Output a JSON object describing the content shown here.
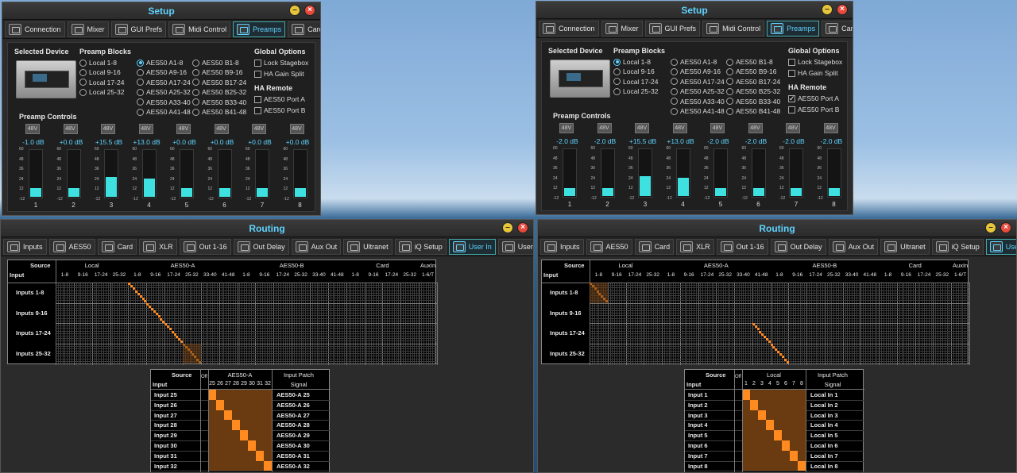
{
  "tabs_setup": [
    "Connection",
    "Mixer",
    "GUI Prefs",
    "Midi Control",
    "Preamps",
    "Card"
  ],
  "tabs_routing": [
    "Inputs",
    "AES50",
    "Card",
    "XLR",
    "Out 1-16",
    "Out Delay",
    "Aux Out",
    "Ultranet",
    "iQ Setup",
    "User In",
    "User Out"
  ],
  "setup_title": "Setup",
  "routing_title": "Routing",
  "labels": {
    "selected_device": "Selected Device",
    "preamp_blocks": "Preamp Blocks",
    "global_options": "Global Options",
    "ha_remote": "HA Remote",
    "preamp_controls": "Preamp Controls",
    "phantom": "48V"
  },
  "blocks": {
    "local": [
      "Local 1-8",
      "Local 9-16",
      "Local 17-24",
      "Local 25-32"
    ],
    "aes_a": [
      "AES50 A1-8",
      "AES50 A9-16",
      "AES50 A17-24",
      "AES50 A25-32",
      "AES50 A33-40",
      "AES50 A41-48"
    ],
    "aes_b": [
      "AES50 B1-8",
      "AES50 B9-16",
      "AES50 B17-24",
      "AES50 B25-32",
      "AES50 B33-40",
      "AES50 B41-48"
    ]
  },
  "global_opts": [
    "Lock Stagebox",
    "HA Gain Split"
  ],
  "ha_opts": [
    "AES50 Port A",
    "AES50 Port B"
  ],
  "scale": [
    "60",
    "48",
    "36",
    "24",
    "12",
    "-12"
  ],
  "channels": [
    "1",
    "2",
    "3",
    "4",
    "5",
    "6",
    "7",
    "8"
  ],
  "left": {
    "selected_block": "AES50 A1-8",
    "ha_port_a_checked": false,
    "gains": [
      "-1.0 dB",
      "+0.0 dB",
      "+15.5 dB",
      "+13.0 dB",
      "+0.0 dB",
      "+0.0 dB",
      "+0.0 dB",
      "+0.0 dB"
    ],
    "levels": [
      0.18,
      0.18,
      0.42,
      0.38,
      0.18,
      0.18,
      0.18,
      0.18
    ]
  },
  "right": {
    "selected_block": "Local 1-8",
    "ha_port_a_checked": true,
    "gains": [
      "-2.0 dB",
      "-2.0 dB",
      "+15.5 dB",
      "+13.0 dB",
      "-2.0 dB",
      "-2.0 dB",
      "-2.0 dB",
      "-2.0 dB"
    ],
    "levels": [
      0.16,
      0.16,
      0.42,
      0.38,
      0.16,
      0.16,
      0.16,
      0.16
    ]
  },
  "matrix": {
    "source": "Source",
    "input": "Input",
    "groups": [
      "Local",
      "AES50-A",
      "AES50-B",
      "Card",
      "AuxIn"
    ],
    "cols": [
      "1-8",
      "9-16",
      "17-24",
      "25-32",
      "1-8",
      "9-16",
      "17-24",
      "25-32",
      "33-40",
      "41-48",
      "1-8",
      "9-16",
      "17-24",
      "25-32",
      "33-40",
      "41-48",
      "1-8",
      "9-16",
      "17-24",
      "25-32",
      "1-6/T"
    ],
    "rows": [
      "Inputs 1-8",
      "Inputs 9-16",
      "Inputs 17-24",
      "Inputs 25-32"
    ]
  },
  "patch_left": {
    "group": "AES50-A",
    "cols": [
      "25",
      "26",
      "27",
      "28",
      "29",
      "30",
      "31",
      "32"
    ],
    "rows": [
      "Input 25",
      "Input 26",
      "Input 27",
      "Input 28",
      "Input 29",
      "Input 30",
      "Input 31",
      "Input 32"
    ],
    "signals": [
      "AES50-A 25",
      "AES50-A 26",
      "AES50-A 27",
      "AES50-A 28",
      "AES50-A 29",
      "AES50-A 30",
      "AES50-A 31",
      "AES50-A 32"
    ]
  },
  "patch_right": {
    "group": "Local",
    "cols": [
      "1",
      "2",
      "3",
      "4",
      "5",
      "6",
      "7",
      "8"
    ],
    "rows": [
      "Input 1",
      "Input 2",
      "Input 3",
      "Input 4",
      "Input 5",
      "Input 6",
      "Input 7",
      "Input 8"
    ],
    "signals": [
      "Local In 1",
      "Local In 2",
      "Local In 3",
      "Local In 4",
      "Local In 5",
      "Local In 6",
      "Local In 7",
      "Local In 8"
    ]
  },
  "patch_hdr": {
    "source": "Source",
    "input": "Input",
    "off": "Off",
    "input_patch": "Input Patch",
    "signal": "Signal"
  }
}
